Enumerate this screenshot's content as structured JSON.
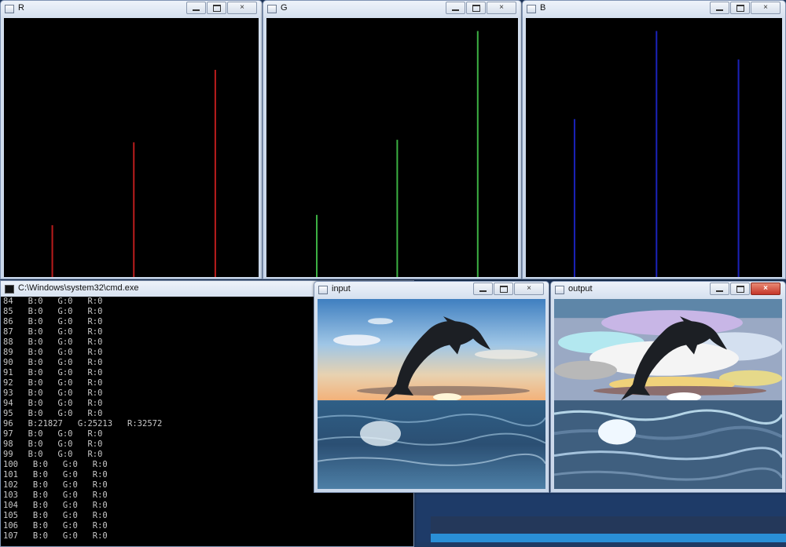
{
  "windows": {
    "r": {
      "title": "R"
    },
    "g": {
      "title": "G"
    },
    "b": {
      "title": "B"
    },
    "cmd": {
      "title": "C:\\Windows\\system32\\cmd.exe"
    },
    "input": {
      "title": "input"
    },
    "output": {
      "title": "output"
    }
  },
  "window_buttons": {
    "minimize": "minimize",
    "maximize": "maximize",
    "close": "×"
  },
  "histograms": {
    "r": {
      "color": "#b81c1c",
      "bars": [
        {
          "x": 0.19,
          "level": 0.2
        },
        {
          "x": 0.51,
          "level": 0.52
        },
        {
          "x": 0.83,
          "level": 0.8
        }
      ]
    },
    "g": {
      "color": "#3cb043",
      "bars": [
        {
          "x": 0.2,
          "level": 0.24
        },
        {
          "x": 0.52,
          "level": 0.53
        },
        {
          "x": 0.84,
          "level": 0.95
        }
      ]
    },
    "b": {
      "color": "#1a22b8",
      "bars": [
        {
          "x": 0.19,
          "level": 0.61
        },
        {
          "x": 0.51,
          "level": 0.95
        },
        {
          "x": 0.83,
          "level": 0.84
        }
      ]
    }
  },
  "cmd_lines": [
    "84   B:0   G:0   R:0",
    "85   B:0   G:0   R:0",
    "86   B:0   G:0   R:0",
    "87   B:0   G:0   R:0",
    "88   B:0   G:0   R:0",
    "89   B:0   G:0   R:0",
    "90   B:0   G:0   R:0",
    "91   B:0   G:0   R:0",
    "92   B:0   G:0   R:0",
    "93   B:0   G:0   R:0",
    "94   B:0   G:0   R:0",
    "95   B:0   G:0   R:0",
    "96   B:21827   G:25213   R:32572",
    "97   B:0   G:0   R:0",
    "98   B:0   G:0   R:0",
    "99   B:0   G:0   R:0",
    "100   B:0   G:0   R:0",
    "101   B:0   G:0   R:0",
    "102   B:0   G:0   R:0",
    "103   B:0   G:0   R:0",
    "104   B:0   G:0   R:0",
    "105   B:0   G:0   R:0",
    "106   B:0   G:0   R:0",
    "107   B:0   G:0   R:0"
  ]
}
